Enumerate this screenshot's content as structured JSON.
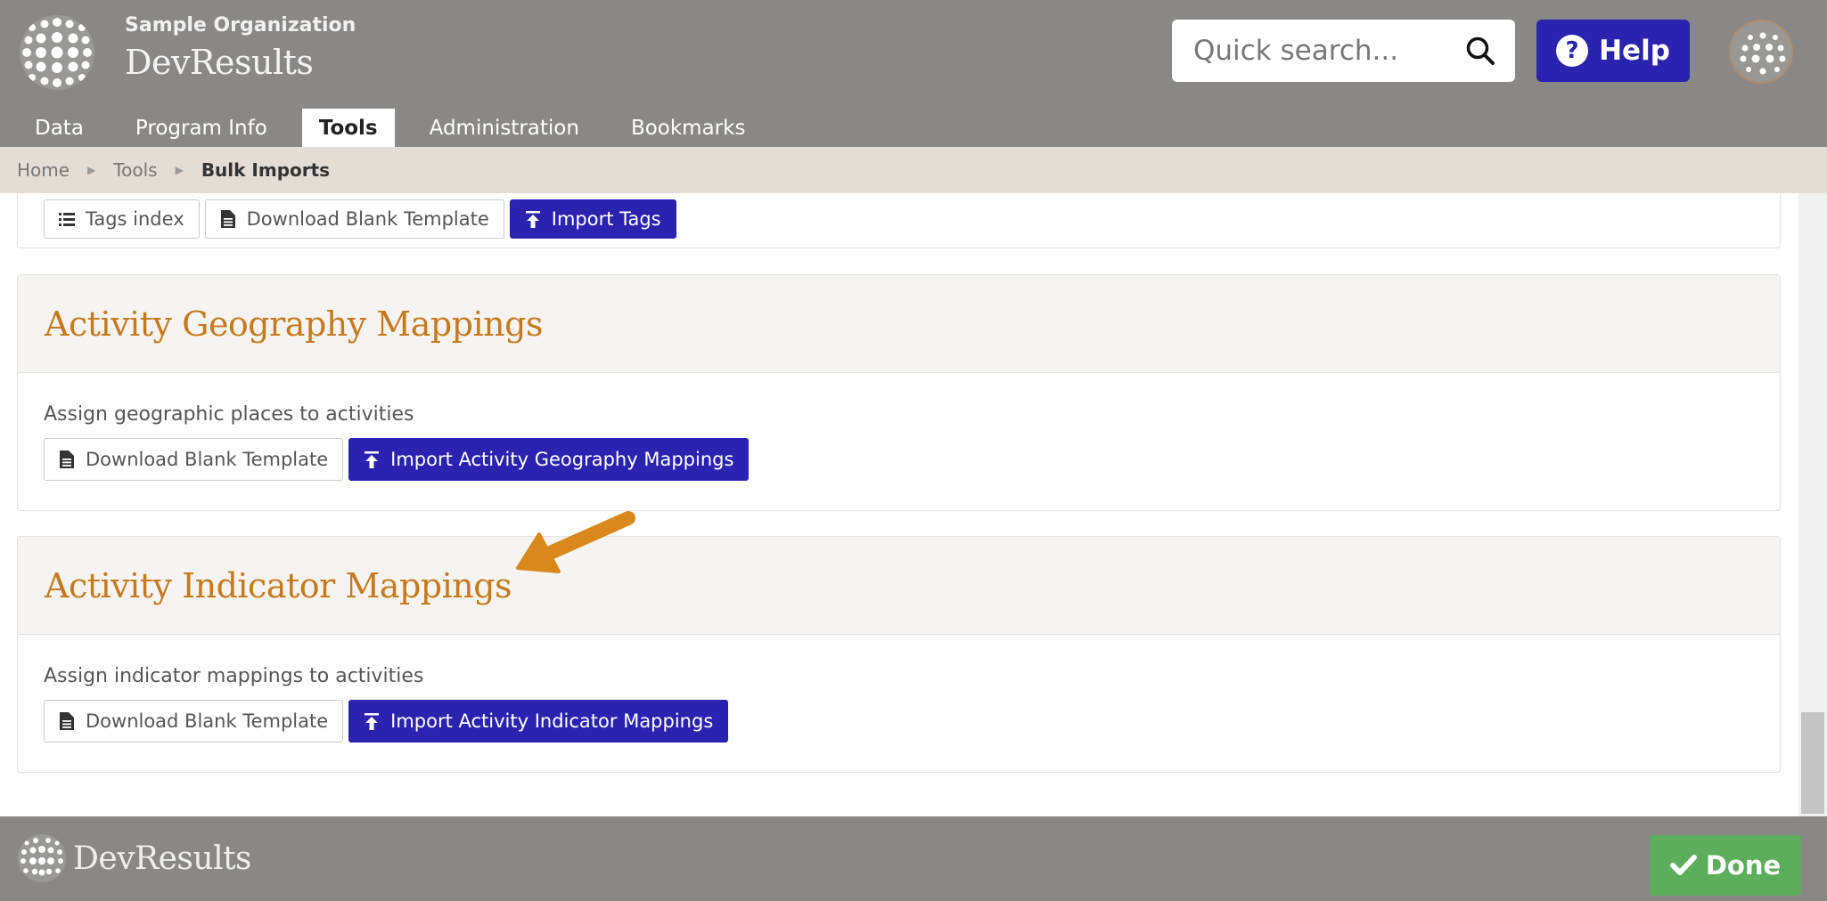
{
  "header": {
    "org_name": "Sample Organization",
    "app_name": "DevResults",
    "search_placeholder": "Quick search...",
    "help_label": "Help"
  },
  "nav": {
    "tabs": [
      {
        "label": "Data",
        "active": false
      },
      {
        "label": "Program Info",
        "active": false
      },
      {
        "label": "Tools",
        "active": true
      },
      {
        "label": "Administration",
        "active": false
      },
      {
        "label": "Bookmarks",
        "active": false
      }
    ]
  },
  "breadcrumb": {
    "items": [
      "Home",
      "Tools"
    ],
    "current": "Bulk Imports"
  },
  "tags_panel": {
    "buttons": {
      "index": "Tags index",
      "download": "Download Blank Template",
      "import": "Import Tags"
    }
  },
  "geo_panel": {
    "title": "Activity Geography Mappings",
    "description": "Assign geographic places to activities",
    "download": "Download Blank Template",
    "import": "Import Activity Geography Mappings"
  },
  "indicator_panel": {
    "title": "Activity Indicator Mappings",
    "description": "Assign indicator mappings to activities",
    "download": "Download Blank Template",
    "import": "Import Activity Indicator Mappings"
  },
  "footer": {
    "logo_text": "DevResults",
    "done_label": "Done"
  },
  "colors": {
    "header_bg": "#898886",
    "primary_button": "#2a23b0",
    "title_orange": "#c67a1c",
    "done_green": "#5cad5c",
    "arrow_orange": "#d9891c"
  }
}
